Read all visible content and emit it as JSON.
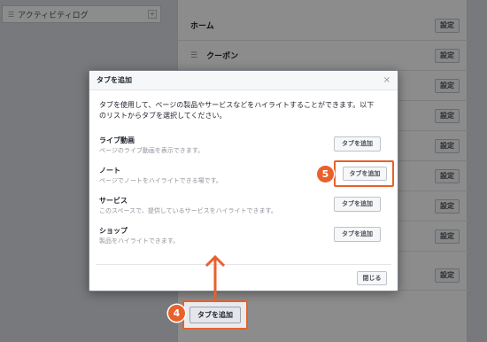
{
  "background": {
    "sidebar": {
      "activity_log": "アクティビティログ"
    },
    "tabs": [
      {
        "label": "ホーム",
        "settings": "設定"
      },
      {
        "label": "クーポン",
        "settings": "設定"
      },
      {
        "label": "",
        "settings": "設定"
      },
      {
        "label": "",
        "settings": "設定"
      },
      {
        "label": "",
        "settings": "設定"
      },
      {
        "label": "",
        "settings": "設定"
      },
      {
        "label": "",
        "settings": "設定"
      },
      {
        "label": "",
        "settings": "設定"
      },
      {
        "label": "",
        "settings": "設定"
      }
    ]
  },
  "dialog": {
    "title": "タブを追加",
    "close_glyph": "×",
    "description_line1": "タブを使用して、ページの製品やサービスなどをハイライトすることができます。以下",
    "description_line2": "のリストからタブを選択してください。",
    "options": [
      {
        "title": "ライブ動画",
        "desc": "ページのライブ動画を表示できます。",
        "button": "タブを追加"
      },
      {
        "title": "ノート",
        "desc": "ページでノートをハイライトできる場です。",
        "button": "タブを追加"
      },
      {
        "title": "サービス",
        "desc": "このスペースで、提供しているサービスをハイライトできます。",
        "button": "タブを追加"
      },
      {
        "title": "ショップ",
        "desc": "製品をハイライトできます。",
        "button": "タブを追加"
      }
    ],
    "close_button": "閉じる"
  },
  "annotations": {
    "step4": "4",
    "step5": "5",
    "add_tab_button": "タブを追加",
    "accent_color": "#e8612c"
  }
}
